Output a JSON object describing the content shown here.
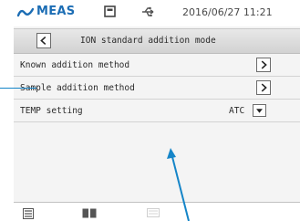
{
  "status_bar": {
    "brand": "MEAS",
    "datetime": "2016/06/27 11:21",
    "icons": [
      "meas-logo-icon",
      "sd-card-icon",
      "usb-icon"
    ]
  },
  "title_bar": {
    "title": "ION standard addition mode",
    "back_icon": "chevron-left-icon"
  },
  "menu": {
    "items": [
      {
        "label": "Known addition method",
        "action_icon": "chevron-right-icon"
      },
      {
        "label": "Sample addition method",
        "action_icon": "chevron-right-icon"
      },
      {
        "label": "TEMP setting",
        "value": "ATC",
        "action_icon": "dropdown-arrow-icon"
      }
    ]
  },
  "bottom_bar": {
    "icons": [
      "list-icon",
      "book-icon",
      "faded-icon"
    ]
  },
  "colors": {
    "brand": "#1c6db4",
    "overlay_line": "#1585c8",
    "title_bar": "#dcdcdc",
    "menu_bg": "#f4f4f4"
  }
}
